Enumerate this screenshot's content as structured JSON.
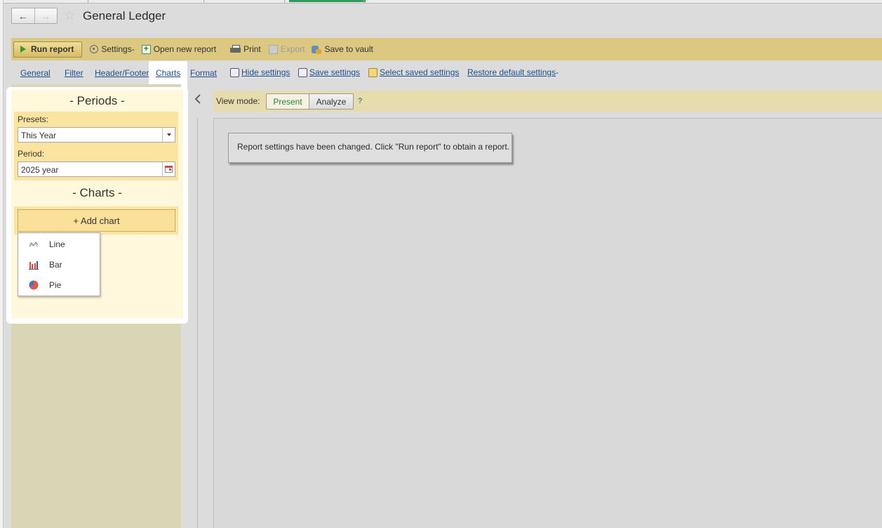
{
  "window": {
    "title": "General Ledger",
    "back_label": "←",
    "forward_label": "→",
    "favorite_icon": "star-icon"
  },
  "toolbar": {
    "run_report": "Run report",
    "settings": "Settings",
    "settings_caret": "-",
    "open_new_report": "Open new report",
    "print": "Print",
    "export": "Export",
    "save_to_vault": "Save to vault"
  },
  "settings_tabs": {
    "tabs": [
      "General",
      "Filter",
      "Header/Footer",
      "Charts",
      "Format"
    ],
    "active_tab": "Charts",
    "hide_settings": "Hide settings",
    "save_settings": "Save settings",
    "select_saved_settings": "Select saved settings",
    "restore_default_settings": "Restore default settings",
    "restore_caret": "-"
  },
  "periods": {
    "heading": "- Periods -",
    "presets_label": "Presets:",
    "presets_value": "This Year",
    "period_label": "Period:",
    "period_value": "2025 year"
  },
  "charts": {
    "heading": "- Charts -",
    "add_chart": "+ Add chart",
    "menu": [
      "Line",
      "Bar",
      "Pie"
    ]
  },
  "view_mode": {
    "label": "View mode:",
    "present": "Present",
    "analyze": "Analyze",
    "active": "Present",
    "help": "?"
  },
  "report": {
    "notice": "Report settings have been changed. Click \"Run report\" to obtain a report."
  },
  "colors": {
    "command_bar": "#ddc882",
    "panel_yellow": "#fff8dc",
    "link": "#1d4f8c",
    "present_active": "#2e7d4a"
  }
}
